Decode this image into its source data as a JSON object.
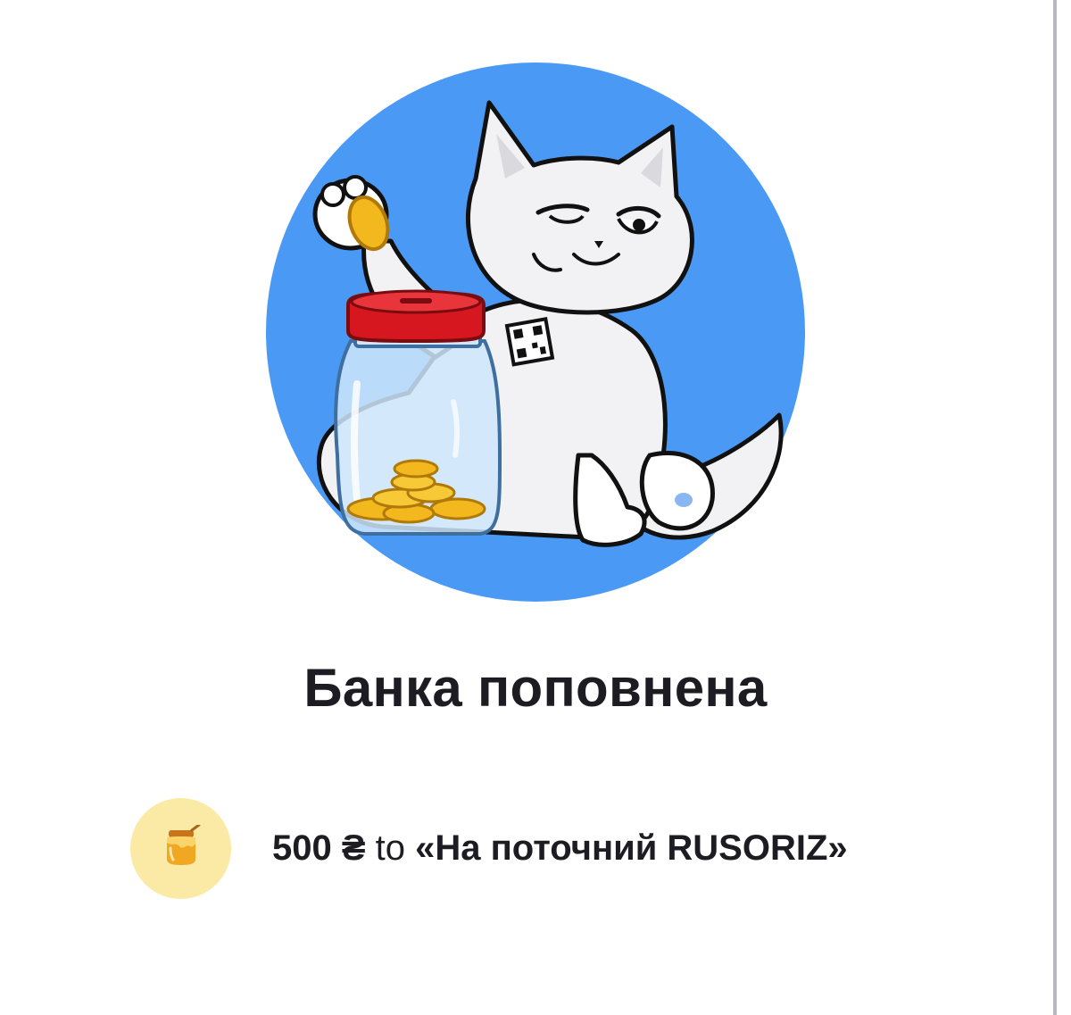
{
  "title": "Банка поповнена",
  "transfer": {
    "amount": "500 ₴",
    "preposition": "to",
    "jar_name": "«На поточний RUSORIZ»"
  },
  "icons": {
    "illustration": "cat-with-coin-jar-illustration",
    "jar_avatar": "honey-jar-icon"
  },
  "colors": {
    "illustration_background": "#4a9af5",
    "avatar_background": "#fbeaa6",
    "jar_lid": "#d6171f",
    "coins": "#f4b81f",
    "text": "#1c1c22"
  }
}
